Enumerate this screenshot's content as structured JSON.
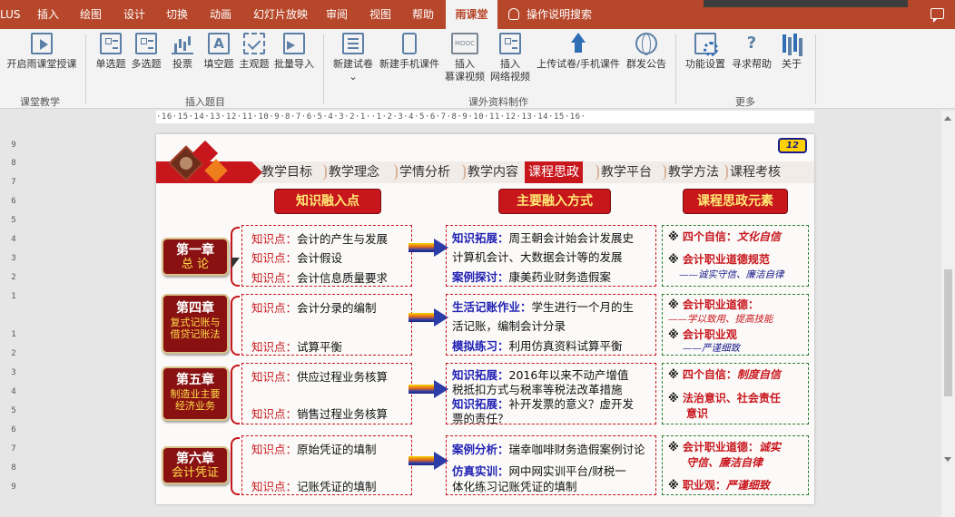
{
  "tabs": {
    "plus": "LUS",
    "insert": "插入",
    "draw": "绘图",
    "design": "设计",
    "transition": "切换",
    "animation": "动画",
    "slideshow": "幻灯片放映",
    "review": "审阅",
    "view": "视图",
    "help": "帮助",
    "rainclass": "雨课堂",
    "tellme": "操作说明搜索"
  },
  "ribbon": {
    "start_class": "开启雨课堂授课",
    "group_class": "课堂教学",
    "single": "单选题",
    "multi": "多选题",
    "vote": "投票",
    "fill": "填空题",
    "subjective": "主观题",
    "batch_import": "批量导入",
    "group_insert": "插入题目",
    "new_paper": "新建试卷",
    "new_mobile": "新建手机课件",
    "insert_mooc_1": "插入",
    "insert_mooc_2": "慕课视频",
    "insert_web_1": "插入",
    "insert_web_2": "网络视频",
    "upload": "上传试卷/手机课件",
    "groups": "群发公告",
    "group_extra": "课外资料制作",
    "settings": "功能设置",
    "seek_help": "寻求帮助",
    "about": "关于",
    "group_more": "更多",
    "mooc_icon_text": "MOOC"
  },
  "ruler": {
    "horizontal": "·16·15·14·13·12·11·10·9·8·7·6·5·4·3·2·1··1·2·3·4·5·6·7·8·9·10·11·12·13·14·15·16·",
    "vertical": [
      "9",
      "8",
      "7",
      "6",
      "5",
      "4",
      "3",
      "2",
      "1",
      "",
      "1",
      "2",
      "3",
      "4",
      "5",
      "6",
      "7",
      "8",
      "9"
    ]
  },
  "slide": {
    "badge": "12",
    "nav": [
      "教学目标",
      "教学理念",
      "学情分析",
      "教学内容",
      "课程思政",
      "教学平台",
      "教学方法",
      "课程考核"
    ],
    "headers": {
      "knowledge": "知识融入点",
      "method": "主要融入方式",
      "elements": "课程思政元素"
    },
    "chapters": [
      {
        "title": "第一章",
        "subtitle": "总  论",
        "knowledge": [
          {
            "k": "知识点：",
            "v": "会计的产生与发展"
          },
          {
            "k": "知识点：",
            "v": "会计假设"
          },
          {
            "k": "知识点：",
            "v": "会计信息质量要求"
          }
        ],
        "method": [
          {
            "k": "知识拓展：",
            "v": "周王朝会计始会计发展史"
          },
          {
            "k": "",
            "v": "计算机会计、大数据会计等的发展"
          },
          {
            "k": "案例探讨：",
            "v": "康美药业财务造假案"
          }
        ],
        "elements": [
          {
            "x": "※ ",
            "k": "四个自信：",
            "s": "文化自信"
          },
          {
            "x": "※ ",
            "k": "会计职业道德规范",
            "s": ""
          },
          {
            "sub": "——诚实守信、廉洁自律"
          }
        ]
      },
      {
        "title": "第四章",
        "subtitle": "复式记账与借贷记账法",
        "knowledge": [
          {
            "k": "知识点：",
            "v": "会计分录的编制"
          },
          {
            "k": "知识点：",
            "v": "试算平衡"
          }
        ],
        "method": [
          {
            "k": "生活记账作业：",
            "v": "学生进行一个月的生"
          },
          {
            "k": "",
            "v": "活记账，编制会计分录"
          },
          {
            "k": "模拟练习：",
            "v": "利用仿真资料试算平衡"
          }
        ],
        "elements": [
          {
            "x": "※ ",
            "k": "会计职业道德：",
            "s": ""
          },
          {
            "subr": "——学以致用、提高技能"
          },
          {
            "x": "※ ",
            "k": "会计职业观",
            "s": ""
          },
          {
            "sub": "——严谨细致"
          }
        ]
      },
      {
        "title": "第五章",
        "subtitle": "制造业主要经济业务",
        "knowledge": [
          {
            "k": "知识点：",
            "v": "供应过程业务核算"
          },
          {
            "k": "知识点：",
            "v": "销售过程业务核算"
          }
        ],
        "method": [
          {
            "k": "知识拓展：",
            "v": "2016年以来不动产增值"
          },
          {
            "k": "",
            "v": "税抵扣方式与税率等税法改革措施"
          },
          {
            "k": "知识拓展：",
            "v": "补开发票的意义？虚开发"
          },
          {
            "k": "",
            "v": "票的责任？"
          }
        ],
        "elements": [
          {
            "x": "※ ",
            "k": "四个自信：",
            "s": "制度自信"
          },
          {
            "x": "※ ",
            "k": "法治意识、社会责任",
            "s": ""
          },
          {
            "kcont": "意识"
          }
        ]
      },
      {
        "title": "第六章",
        "subtitle": "会计凭证",
        "knowledge": [
          {
            "k": "知识点：",
            "v": "原始凭证的填制"
          },
          {
            "k": "知识点：",
            "v": "记账凭证的填制"
          }
        ],
        "method": [
          {
            "k": "案例分析：",
            "v": "瑞幸咖啡财务造假案例讨论"
          },
          {
            "k": "仿真实训：",
            "v": "网中网实训平台/财税一"
          },
          {
            "k": "",
            "v": "体化练习记账凭证的填制"
          }
        ],
        "elements": [
          {
            "x": "※ ",
            "k": "会计职业道德：",
            "s": "诚实"
          },
          {
            "s2": "守信、廉洁自律"
          },
          {
            "x": "※ ",
            "k": "职业观：",
            "s": "严谨细致"
          }
        ]
      }
    ]
  },
  "colors": {
    "accent": "#b7472a",
    "slide_red": "#c8161d",
    "header_yellow": "#ffe873",
    "chapter_bg": "#8a1111",
    "method_blue": "#2222b5",
    "element_green_border": "#2e7d32"
  }
}
